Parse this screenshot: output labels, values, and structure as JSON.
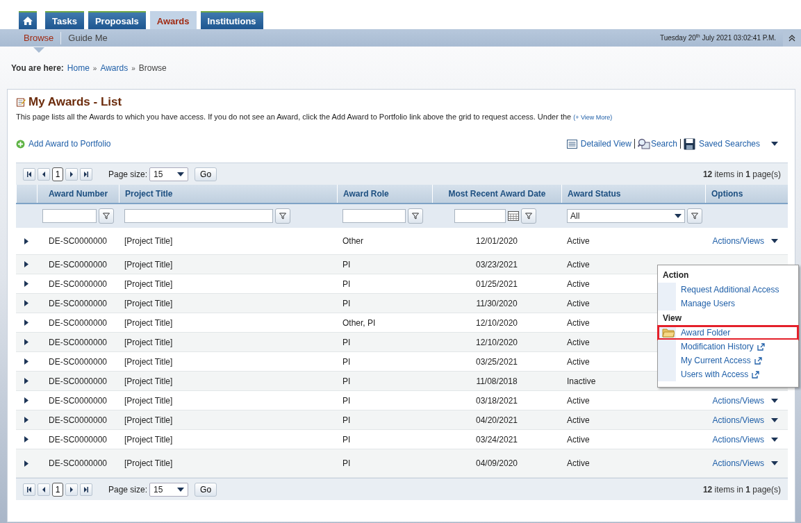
{
  "tabs": [
    {
      "label": "Tasks",
      "selected": false
    },
    {
      "label": "Proposals",
      "selected": false
    },
    {
      "label": "Awards",
      "selected": true
    },
    {
      "label": "Institutions",
      "selected": false
    }
  ],
  "subnav": [
    {
      "label": "Browse",
      "selected": true
    },
    {
      "label": "Guide Me",
      "selected": false
    }
  ],
  "datetime": "Tuesday 20$^{th}$ July 2021 03:02:41 P.M.",
  "breadcrumb": {
    "label": "You are here:",
    "links": [
      "Home",
      "Awards"
    ],
    "current": "Browse",
    "separator": "»"
  },
  "page": {
    "title": "My Awards - List",
    "description": "This page lists all the Awards to which you have access. If you do not see an Award, click the Add Award to Portfolio link above the grid to request access. Under the",
    "view_more": "(+ View More)"
  },
  "toolbar": {
    "add": "Add Award to Portfolio",
    "detailed_view": "Detailed View",
    "search": "Search",
    "saved_searches": "Saved Searches"
  },
  "pagers": [
    {
      "page": "1",
      "page_size_label": "Page size:",
      "page_size": "15",
      "go": "Go",
      "summary": "**12** items in **1** page(s)"
    },
    {
      "page": "1",
      "page_size_label": "Page size:",
      "page_size": "15",
      "go": "Go",
      "summary": "**12** items in **1** page(s)"
    }
  ],
  "table": {
    "columns": [
      "Award Number",
      "Project Title",
      "Award Role",
      "Most Recent Award Date",
      "Award Status",
      "Options"
    ],
    "status_filter": "All",
    "rows": [
      {
        "award_number": "DE-SC0000000",
        "project_title": "[Project Title]",
        "award_role": "Other",
        "date": "12/01/2020",
        "status": "Active",
        "actions": "Actions/Views"
      },
      {
        "award_number": "DE-SC0000000",
        "project_title": "[Project Title]",
        "award_role": "PI",
        "date": "03/23/2021",
        "status": "Active"
      },
      {
        "award_number": "DE-SC0000000",
        "project_title": "[Project Title]",
        "award_role": "PI",
        "date": "01/25/2021",
        "status": "Active"
      },
      {
        "award_number": "DE-SC0000000",
        "project_title": "[Project Title]",
        "award_role": "PI",
        "date": "11/30/2020",
        "status": "Active"
      },
      {
        "award_number": "DE-SC0000000",
        "project_title": "[Project Title]",
        "award_role": "Other, PI",
        "date": "12/10/2020",
        "status": "Active"
      },
      {
        "award_number": "DE-SC0000000",
        "project_title": "[Project Title]",
        "award_role": "PI",
        "date": "12/10/2020",
        "status": "Active"
      },
      {
        "award_number": "DE-SC0000000",
        "project_title": "[Project Title]",
        "award_role": "PI",
        "date": "03/25/2021",
        "status": "Active"
      },
      {
        "award_number": "DE-SC0000000",
        "project_title": "[Project Title]",
        "award_role": "PI",
        "date": "11/08/2018",
        "status": "Inactive"
      },
      {
        "award_number": "DE-SC0000000",
        "project_title": "[Project Title]",
        "award_role": "PI",
        "date": "03/18/2021",
        "status": "Active",
        "actions": "Actions/Views"
      },
      {
        "award_number": "DE-SC0000000",
        "project_title": "[Project Title]",
        "award_role": "PI",
        "date": "04/20/2021",
        "status": "Active",
        "actions": "Actions/Views"
      },
      {
        "award_number": "DE-SC0000000",
        "project_title": "[Project Title]",
        "award_role": "PI",
        "date": "03/24/2021",
        "status": "Active",
        "actions": "Actions/Views"
      },
      {
        "award_number": "DE-SC0000000",
        "project_title": "[Project Title]",
        "award_role": "PI",
        "date": "04/09/2020",
        "status": "Active",
        "actions": "Actions/Views"
      }
    ]
  },
  "actions_menu": {
    "sections": [
      {
        "heading": "Action",
        "items": [
          {
            "label": "Request Additional Access",
            "kind": "plain",
            "highlighted": false
          },
          {
            "label": "Manage Users",
            "kind": "plain",
            "highlighted": false
          }
        ]
      },
      {
        "heading": "View",
        "items": [
          {
            "label": "Award Folder",
            "kind": "folder",
            "highlighted": true
          },
          {
            "label": "Modification History",
            "kind": "external",
            "highlighted": false
          },
          {
            "label": "My Current Access",
            "kind": "external",
            "highlighted": false
          },
          {
            "label": "Users with Access",
            "kind": "external",
            "highlighted": false
          }
        ]
      }
    ]
  }
}
